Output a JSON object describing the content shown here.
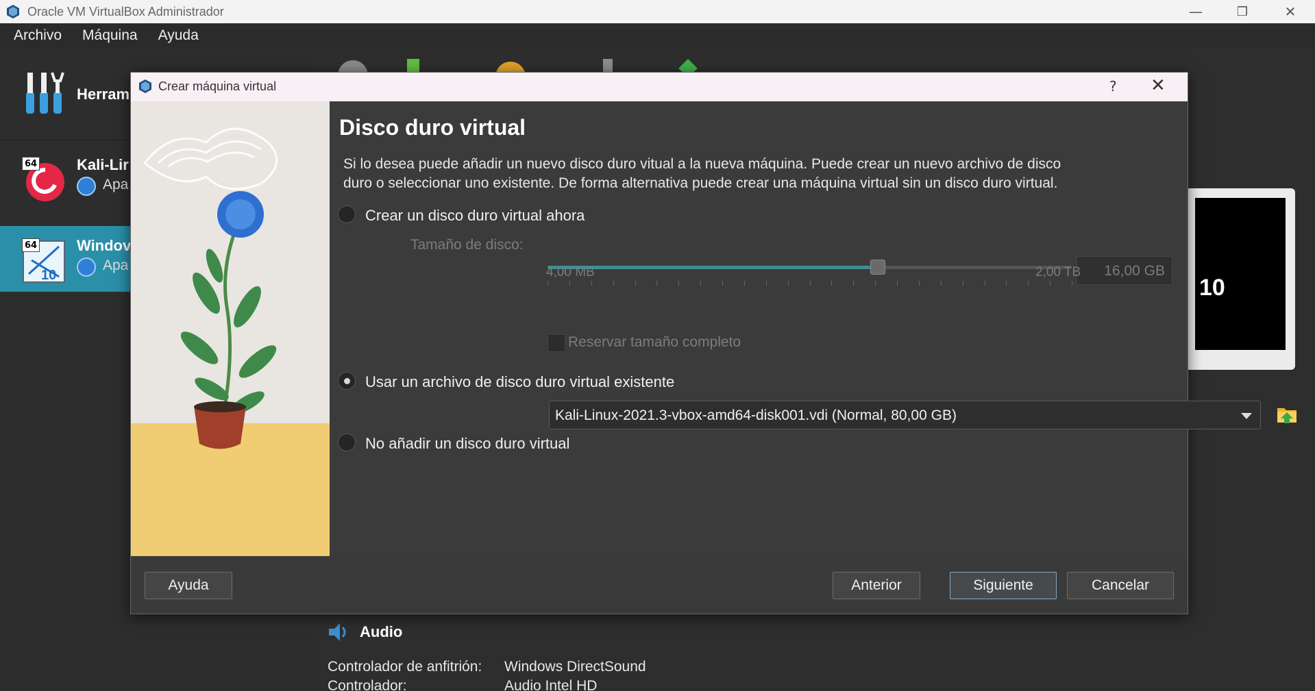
{
  "window": {
    "title": "Oracle VM VirtualBox Administrador",
    "minimize": "—",
    "restore": "❐",
    "close": "✕"
  },
  "menu": [
    "Archivo",
    "Máquina",
    "Ayuda"
  ],
  "sidebar": {
    "tools_label": "Herram",
    "vms": [
      {
        "name": "Kali-Lir",
        "state": "Apa",
        "badge": "64"
      },
      {
        "name": "Windov",
        "state": "Apa",
        "badge": "64",
        "selected": true
      }
    ]
  },
  "details": {
    "preview_text": "10",
    "audio_section": "Audio",
    "rows": [
      {
        "label": "Controlador de anfitrión:",
        "value": "Windows DirectSound"
      },
      {
        "label": "Controlador:",
        "value": "Audio Intel HD"
      }
    ]
  },
  "dialog": {
    "title": "Crear máquina virtual",
    "help_symbol": "?",
    "close_symbol": "✕",
    "heading": "Disco duro virtual",
    "description": "Si lo desea puede añadir un nuevo disco duro vitual a la nueva máquina. Puede crear un nuevo archivo de disco duro o seleccionar uno existente. De forma alternativa puede crear una máquina virtual sin un disco duro virtual.",
    "option_create": "Crear un disco duro virtual ahora",
    "disk_size_label": "Tamaño de disco:",
    "disk_size_value": "16,00 GB",
    "disk_size_fraction": 0.63,
    "slider_min": "4,00 MB",
    "slider_max": "2,00 TB",
    "reserve_label": "Reservar tamaño completo",
    "option_existing": "Usar un archivo de disco duro virtual existente",
    "existing_file": "Kali-Linux-2021.3-vbox-amd64-disk001.vdi (Normal, 80,00 GB)",
    "option_none": "No añadir un disco duro virtual",
    "selected_option": "existing",
    "buttons": {
      "help": "Ayuda",
      "back": "Anterior",
      "next": "Siguiente",
      "cancel": "Cancelar"
    }
  }
}
